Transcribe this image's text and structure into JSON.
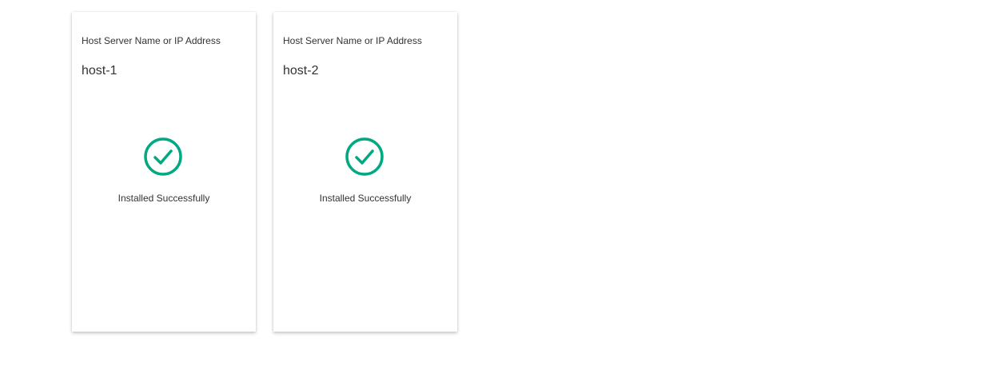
{
  "colors": {
    "success": "#01a982"
  },
  "hosts": [
    {
      "field_label": "Host Server Name or IP Address",
      "host_name": "host-1",
      "status_icon": "check-circle-icon",
      "status_text": "Installed Successfully"
    },
    {
      "field_label": "Host Server Name or IP Address",
      "host_name": "host-2",
      "status_icon": "check-circle-icon",
      "status_text": "Installed Successfully"
    }
  ]
}
